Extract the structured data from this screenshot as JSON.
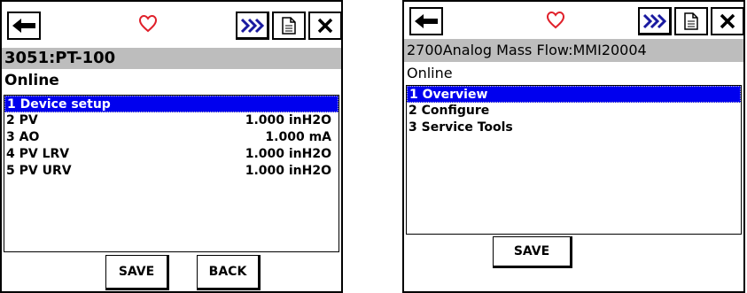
{
  "left_screen": {
    "device_tag": "3051:PT-100",
    "status": "Online",
    "menu": [
      {
        "label": "1 Device setup",
        "value": "",
        "selected": true
      },
      {
        "label": "2 PV",
        "value": "1.000 inH2O",
        "selected": false
      },
      {
        "label": "3 AO",
        "value": "1.000 mA",
        "selected": false
      },
      {
        "label": "4 PV LRV",
        "value": "1.000 inH2O",
        "selected": false
      },
      {
        "label": "5 PV URV",
        "value": "1.000 inH2O",
        "selected": false
      }
    ],
    "buttons": {
      "save": "SAVE",
      "back": "BACK"
    }
  },
  "right_screen": {
    "device_tag": "2700Analog Mass Flow:MMI20004",
    "status": "Online",
    "menu": [
      {
        "label": "1 Overview",
        "selected": true
      },
      {
        "label": "2 Configure",
        "selected": false
      },
      {
        "label": "3 Service Tools",
        "selected": false
      }
    ],
    "buttons": {
      "save": "SAVE"
    }
  },
  "toolbar_icons": [
    "back-arrow-icon",
    "heart-icon",
    "fast-forward-icon",
    "document-icon",
    "close-icon"
  ],
  "colors": {
    "selection": "#0000ee",
    "heart": "#e0202a",
    "title_bar": "#bdbdbd",
    "forward_icon": "#1a1aa0"
  }
}
